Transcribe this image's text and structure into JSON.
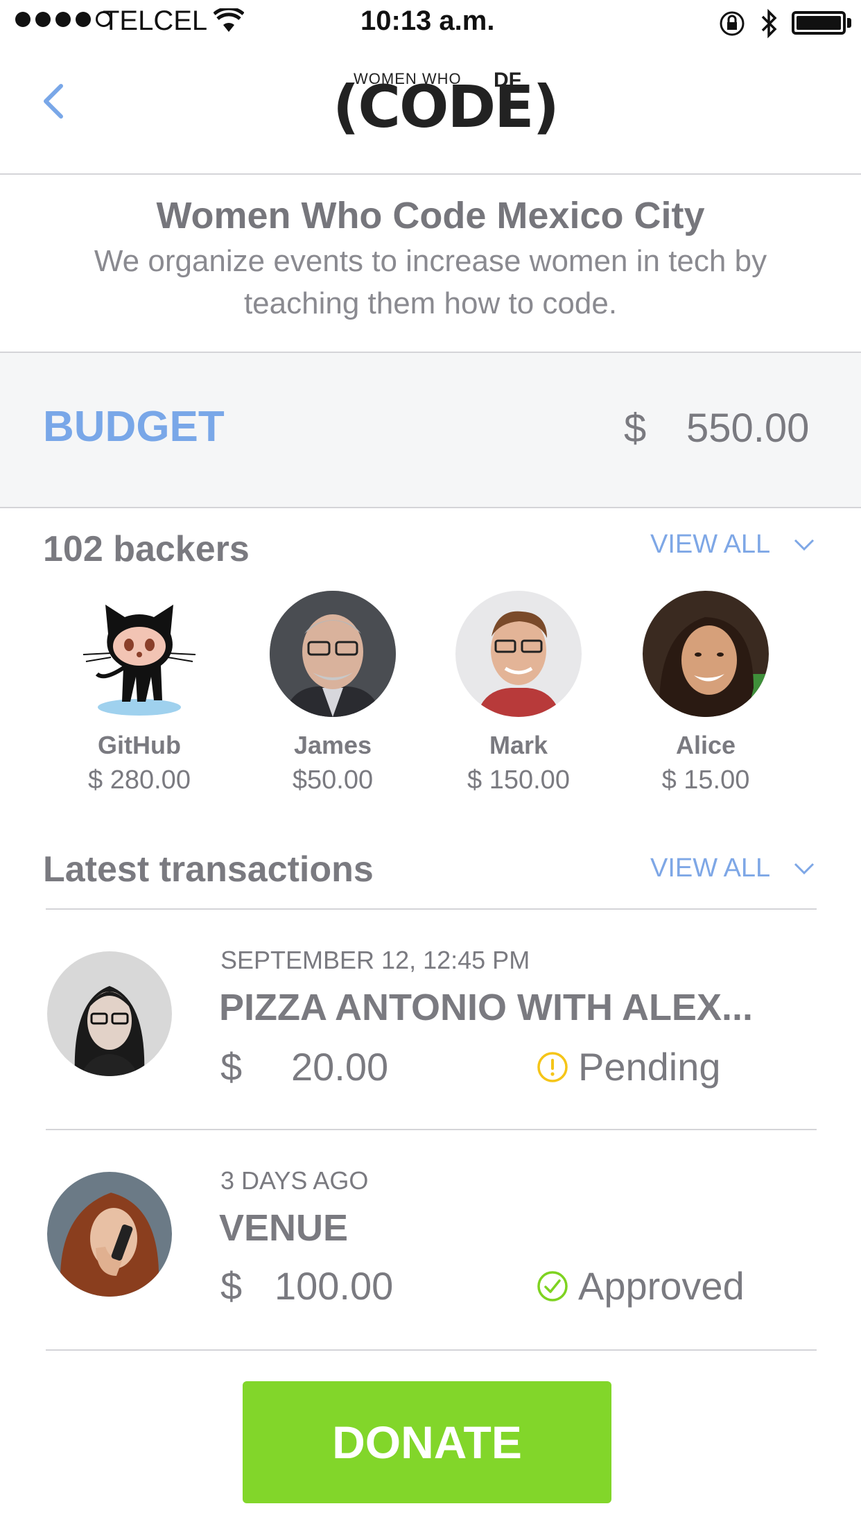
{
  "status_bar": {
    "carrier": "TELCEL",
    "time": "10:13 a.m."
  },
  "header": {
    "logo_top": "WOMEN WHO",
    "logo_main": "(CODE)",
    "logo_suffix": "DF"
  },
  "org": {
    "title": "Women Who Code Mexico City",
    "description": "We organize events to increase women in tech by teaching them how to code."
  },
  "budget": {
    "label": "BUDGET",
    "currency": "$",
    "amount": "550.00"
  },
  "backers": {
    "title": "102 backers",
    "view_all": "VIEW ALL",
    "items": [
      {
        "name": "GitHub",
        "amount": "$ 280.00"
      },
      {
        "name": "James",
        "amount": "$50.00"
      },
      {
        "name": "Mark",
        "amount": "$ 150.00"
      },
      {
        "name": "Alice",
        "amount": "$ 15.00"
      }
    ]
  },
  "transactions": {
    "title": "Latest transactions",
    "view_all": "VIEW ALL",
    "items": [
      {
        "date": "SEPTEMBER 12, 12:45 PM",
        "title": "PIZZA ANTONIO WITH ALEX...",
        "currency": "$",
        "amount": "20.00",
        "status": "Pending",
        "status_color": "#f5c518"
      },
      {
        "date": "3 DAYS AGO",
        "title": "VENUE",
        "currency": "$",
        "amount": "100.00",
        "status": "Approved",
        "status_color": "#7ed321"
      }
    ]
  },
  "donate_label": "DONATE",
  "colors": {
    "accent_blue": "#79a7e8",
    "donate_green": "#82d62a",
    "pending": "#f5c518",
    "approved": "#7ed321"
  }
}
